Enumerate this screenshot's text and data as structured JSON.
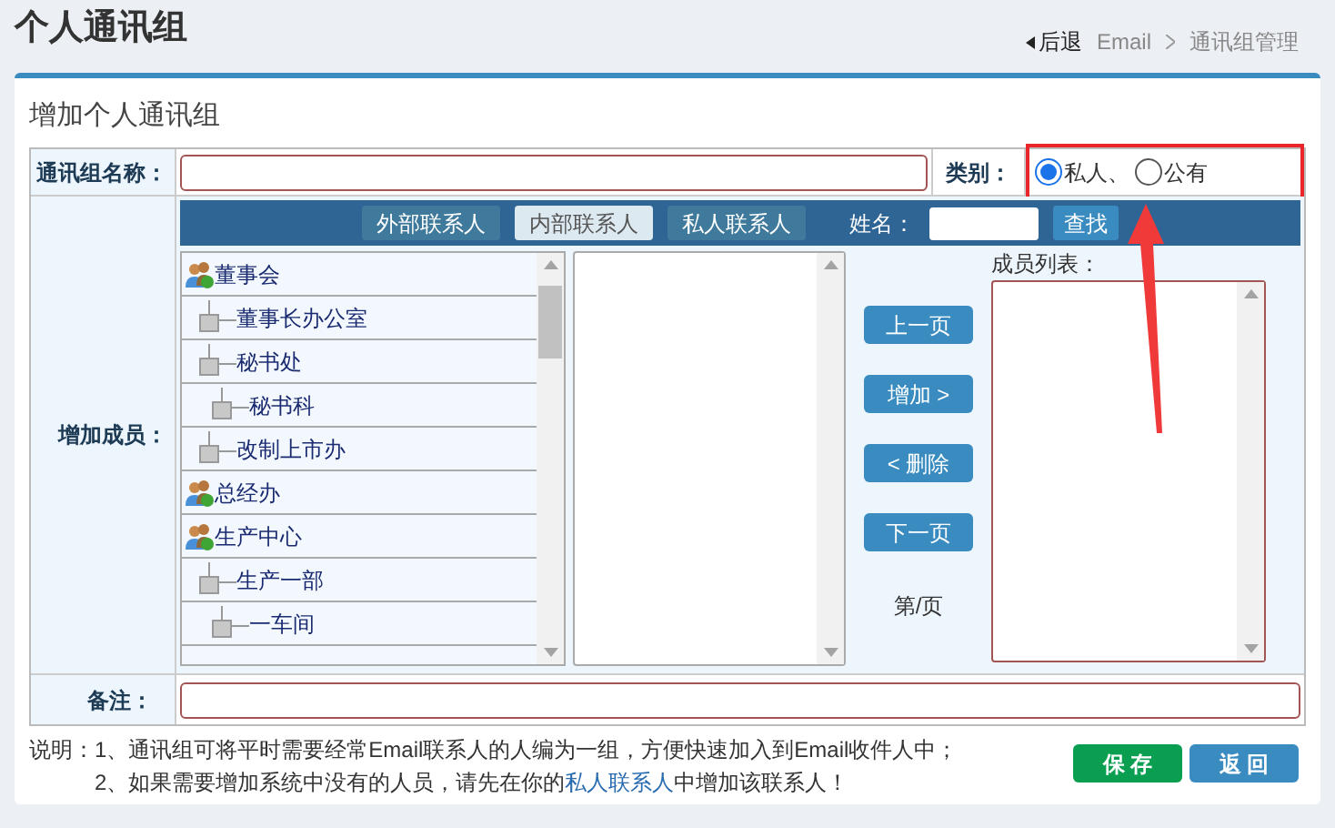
{
  "page_title": "个人通讯组",
  "breadcrumb": {
    "back": "后退",
    "items": [
      "Email",
      "通讯组管理"
    ]
  },
  "form": {
    "title": "增加个人通讯组",
    "name_label": "通讯组名称：",
    "category_label": "类别：",
    "category_options": [
      {
        "label": "私人、",
        "selected": true
      },
      {
        "label": "公有",
        "selected": false
      }
    ],
    "members_label": "增加成员：",
    "contact_tabs": [
      {
        "label": "外部联系人",
        "selected": false
      },
      {
        "label": "内部联系人",
        "selected": true
      },
      {
        "label": "私人联系人",
        "selected": false
      }
    ],
    "search_label": "姓名：",
    "search_button": "查找",
    "tree": [
      {
        "kind": "group",
        "label": "董事会",
        "children": [
          {
            "kind": "node",
            "label": "董事长办公室"
          },
          {
            "kind": "node",
            "label": "秘书处",
            "children": [
              {
                "kind": "node",
                "label": "秘书科"
              }
            ]
          },
          {
            "kind": "node",
            "label": "改制上市办"
          }
        ]
      },
      {
        "kind": "group",
        "label": "总经办"
      },
      {
        "kind": "group",
        "label": "生产中心",
        "children": [
          {
            "kind": "node",
            "label": "生产一部",
            "children": [
              {
                "kind": "node",
                "label": "一车间"
              }
            ]
          }
        ]
      }
    ],
    "middle_buttons": [
      "上一页",
      "增加 >",
      "< 删除",
      "下一页"
    ],
    "page_info": "第/页",
    "member_list_label": "成员列表：",
    "note_label": "备注：",
    "notes": [
      "说明：1、通讯组可将平时需要经常Email联系人的人编为一组，方便快速加入到Email收件人中；",
      "2、如果需要增加系统中没有的人员，请先在你的",
      "私人联系人",
      "中增加该联系人！"
    ],
    "save_button": "保 存",
    "back_button": "返 回"
  }
}
